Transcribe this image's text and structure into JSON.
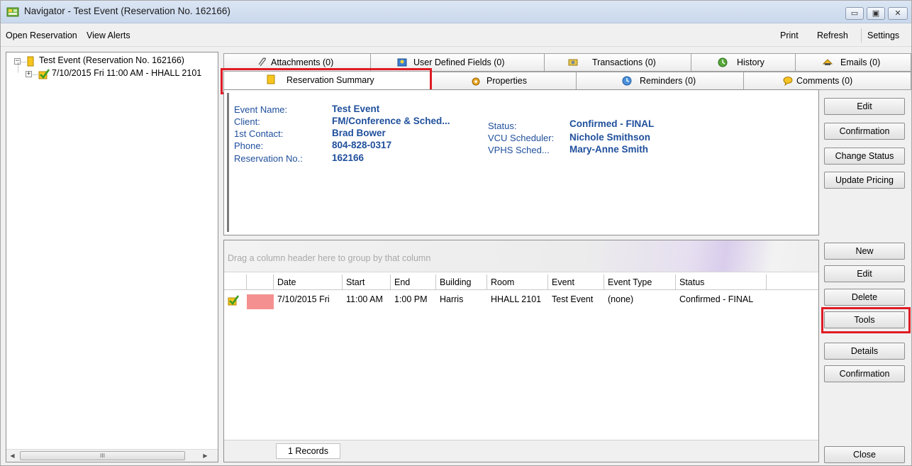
{
  "window": {
    "title": "Navigator - Test Event (Reservation No. 162166)",
    "controls": {
      "minimize": "▭",
      "maximize": "▣",
      "close": "✕"
    }
  },
  "menu": {
    "left": [
      "Open Reservation",
      "View Alerts"
    ],
    "right": [
      "Print",
      "Refresh",
      "Settings"
    ]
  },
  "tree": {
    "root_label": "Test Event (Reservation No. 162166)",
    "child_label": "7/10/2015 Fri 11:00 AM - HHALL 2101",
    "expander_root": "−",
    "expander_child": "+",
    "scroll_thumb_grip": "III"
  },
  "tabs": {
    "row1": [
      "Attachments (0)",
      "User Defined Fields (0)",
      "Transactions (0)",
      "History",
      "Emails (0)"
    ],
    "row2": [
      "Reservation Summary",
      "Properties",
      "Reminders (0)",
      "Comments (0)"
    ],
    "active": "Reservation Summary"
  },
  "summary": {
    "event_name_label": "Event Name:",
    "event_name": "Test Event",
    "client_label": "Client:",
    "client": "FM/Conference & Sched...",
    "contact_label": "1st Contact:",
    "contact": "Brad Bower",
    "phone_label": "Phone:",
    "phone": "804-828-0317",
    "reservation_label": "Reservation No.:",
    "reservation": "162166",
    "status_label": "Status:",
    "status": "Confirmed - FINAL",
    "vcu_label": "VCU Scheduler:",
    "vcu": "Nichole Smithson",
    "vphs_label": "VPHS Sched...",
    "vphs": "Mary-Anne Smith"
  },
  "summary_buttons": [
    "Edit",
    "Confirmation",
    "Change Status",
    "Update Pricing"
  ],
  "grid": {
    "group_hint": "Drag a column header here to group by that column",
    "columns": [
      "Date",
      "Start",
      "End",
      "Building",
      "Room",
      "Event",
      "Event Type",
      "Status"
    ],
    "rows": [
      {
        "date": "7/10/2015 Fri",
        "start": "11:00 AM",
        "end": "1:00 PM",
        "building": "Harris",
        "room": "HHALL 2101",
        "event": "Test Event",
        "event_type": "(none)",
        "status": "Confirmed - FINAL"
      }
    ],
    "records": "1 Records"
  },
  "grid_buttons": [
    "New",
    "Edit",
    "Delete",
    "Tools",
    "Details",
    "Confirmation"
  ],
  "close_button": "Close",
  "colors": {
    "accent_text": "#1f4f9c",
    "highlight": "#e01b24",
    "row_status": "#f59090"
  }
}
